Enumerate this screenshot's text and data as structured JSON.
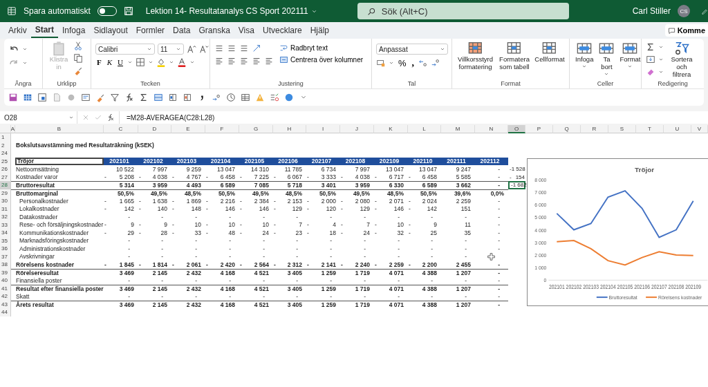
{
  "title_bar": {
    "autosave_label": "Spara automatiskt",
    "autosave_on": false,
    "document_title": "Lektion 14- Resultatanalys CS Sport 202111",
    "search_placeholder": "Sök (Alt+C)",
    "user_name": "Carl Stiller",
    "user_initials": "CS"
  },
  "menu_tabs": [
    {
      "label": "Arkiv",
      "selected": false
    },
    {
      "label": "Start",
      "selected": true
    },
    {
      "label": "Infoga",
      "selected": false
    },
    {
      "label": "Sidlayout",
      "selected": false
    },
    {
      "label": "Formler",
      "selected": false
    },
    {
      "label": "Data",
      "selected": false
    },
    {
      "label": "Granska",
      "selected": false
    },
    {
      "label": "Visa",
      "selected": false
    },
    {
      "label": "Utvecklare",
      "selected": false
    },
    {
      "label": "Hjälp",
      "selected": false
    }
  ],
  "comments_button": "Komme",
  "ribbon": {
    "undo_group": "Ångra",
    "clipboard": {
      "name": "Urklipp",
      "paste": "Klistra in",
      "paste_disabled": true
    },
    "font": {
      "name": "Tecken",
      "family": "Calibri",
      "size": "11",
      "bold": "F",
      "italic": "K",
      "underline": "U"
    },
    "alignment": {
      "name": "Justering",
      "wrap": "Radbryt text",
      "merge": "Centrera över kolumner"
    },
    "number": {
      "name": "Tal",
      "format": "Anpassat",
      "percent": "%",
      "comma": ","
    },
    "styles": {
      "name": "Format",
      "buttons": [
        "Villkorsstyrd formatering",
        "Formatera som tabell",
        "Cellformat"
      ]
    },
    "cells": {
      "name": "Celler",
      "buttons": [
        "Infoga",
        "Ta bort",
        "Format"
      ]
    },
    "editing": {
      "name": "Redigering",
      "sort": "Sortera och filtrera"
    }
  },
  "formula_bar": {
    "name_box": "O28",
    "formula": "=M28-AVERAGEA(C28:L28)"
  },
  "sheet": {
    "columns": [
      {
        "label": "A",
        "selected": false
      },
      {
        "label": "B",
        "selected": false
      },
      {
        "label": "C",
        "selected": false
      },
      {
        "label": "D",
        "selected": false
      },
      {
        "label": "E",
        "selected": false
      },
      {
        "label": "F",
        "selected": false
      },
      {
        "label": "G",
        "selected": false
      },
      {
        "label": "H",
        "selected": false
      },
      {
        "label": "I",
        "selected": false
      },
      {
        "label": "J",
        "selected": false
      },
      {
        "label": "K",
        "selected": false
      },
      {
        "label": "L",
        "selected": false
      },
      {
        "label": "M",
        "selected": false
      },
      {
        "label": "N",
        "selected": false
      },
      {
        "label": "O",
        "selected": true
      },
      {
        "label": "P",
        "selected": false
      },
      {
        "label": "Q",
        "selected": false
      },
      {
        "label": "R",
        "selected": false
      },
      {
        "label": "S",
        "selected": false
      },
      {
        "label": "T",
        "selected": false
      },
      {
        "label": "U",
        "selected": false
      },
      {
        "label": "V",
        "selected": false
      }
    ],
    "rows": [
      {
        "kind": "blank",
        "number": "1",
        "selected": false
      },
      {
        "kind": "title",
        "number": "2",
        "selected": false,
        "label": "Bokslutsavstämning med Resultaträkning (kSEK)"
      },
      {
        "kind": "blank",
        "number": "24",
        "selected": false
      },
      {
        "kind": "header",
        "number": "25",
        "selected": false,
        "label": "Tröjor",
        "months": [
          "202101",
          "202102",
          "202103",
          "202104",
          "202105",
          "202106",
          "202107",
          "202108",
          "202109",
          "202110",
          "202111",
          "202112"
        ]
      },
      {
        "kind": "data",
        "number": "26",
        "selected": false,
        "label": "Nettoomsättning",
        "bold": false,
        "indent": false,
        "border_top": false,
        "cells": [
          [
            "10 522"
          ],
          [
            "7 997"
          ],
          [
            "9 259"
          ],
          [
            "13 047"
          ],
          [
            "14 310"
          ],
          [
            "11 785"
          ],
          [
            "6 734"
          ],
          [
            "7 997"
          ],
          [
            "13 047"
          ],
          [
            "13 047"
          ],
          [
            "9 247"
          ],
          [
            "-"
          ]
        ],
        "extra": {
          "cell": [
            "-",
            "1 528"
          ],
          "selected": false
        }
      },
      {
        "kind": "data",
        "number": "27",
        "selected": false,
        "label": "Kostnader varor",
        "bold": false,
        "indent": false,
        "border_top": false,
        "cells": [
          [
            "-",
            "5 208"
          ],
          [
            "-",
            "4 038"
          ],
          [
            "-",
            "4 767"
          ],
          [
            "-",
            "6 458"
          ],
          [
            "-",
            "7 225"
          ],
          [
            "-",
            "6 067"
          ],
          [
            "-",
            "3 333"
          ],
          [
            "-",
            "4 038"
          ],
          [
            "-",
            "6 717"
          ],
          [
            "-",
            "6 458"
          ],
          [
            "5 585"
          ],
          [
            "-"
          ]
        ],
        "extra": {
          "cell": [
            "-",
            "154"
          ],
          "selected": false
        }
      },
      {
        "kind": "data",
        "number": "28",
        "selected": true,
        "label": "Bruttoresultat",
        "bold": true,
        "indent": false,
        "border_top": true,
        "cells": [
          [
            "5 314"
          ],
          [
            "3 959"
          ],
          [
            "4 493"
          ],
          [
            "6 589"
          ],
          [
            "7 085"
          ],
          [
            "5 718"
          ],
          [
            "3 401"
          ],
          [
            "3 959"
          ],
          [
            "6 330"
          ],
          [
            "6 589"
          ],
          [
            "3 662"
          ],
          [
            "-"
          ]
        ],
        "extra": {
          "cell": [
            "-",
            "1 682"
          ],
          "selected": true
        }
      },
      {
        "kind": "data",
        "number": "29",
        "selected": false,
        "label": "Bruttomarginal",
        "bold": true,
        "indent": false,
        "border_top": true,
        "cells": [
          [
            "50,5%"
          ],
          [
            "49,5%"
          ],
          [
            "48,5%"
          ],
          [
            "50,5%"
          ],
          [
            "49,5%"
          ],
          [
            "48,5%"
          ],
          [
            "50,5%"
          ],
          [
            "49,5%"
          ],
          [
            "48,5%"
          ],
          [
            "50,5%"
          ],
          [
            "39,6%"
          ],
          [
            "0,0%"
          ]
        ]
      },
      {
        "kind": "data",
        "number": "30",
        "selected": false,
        "label": "Personalkostnader",
        "bold": false,
        "indent": true,
        "border_top": false,
        "cells": [
          [
            "-",
            "1 665"
          ],
          [
            "-",
            "1 638"
          ],
          [
            "-",
            "1 869"
          ],
          [
            "-",
            "2 216"
          ],
          [
            "-",
            "2 384"
          ],
          [
            "-",
            "2 153"
          ],
          [
            "-",
            "2 000"
          ],
          [
            "-",
            "2 080"
          ],
          [
            "-",
            "2 071"
          ],
          [
            "-",
            "2 024"
          ],
          [
            "2 259"
          ],
          [
            "-"
          ]
        ]
      },
      {
        "kind": "data",
        "number": "31",
        "selected": false,
        "label": "Lokalkostnader",
        "bold": false,
        "indent": true,
        "border_top": false,
        "cells": [
          [
            "-",
            "142"
          ],
          [
            "-",
            "140"
          ],
          [
            "-",
            "148"
          ],
          [
            "-",
            "146"
          ],
          [
            "-",
            "146"
          ],
          [
            "-",
            "129"
          ],
          [
            "-",
            "120"
          ],
          [
            "-",
            "129"
          ],
          [
            "-",
            "146"
          ],
          [
            "-",
            "142"
          ],
          [
            "151"
          ],
          [
            "-"
          ]
        ]
      },
      {
        "kind": "data",
        "number": "32",
        "selected": false,
        "label": "Datakostnader",
        "bold": false,
        "indent": true,
        "border_top": false,
        "cells": [
          [
            "-"
          ],
          [
            "-"
          ],
          [
            "-"
          ],
          [
            "-"
          ],
          [
            "-"
          ],
          [
            "-"
          ],
          [
            "-"
          ],
          [
            "-"
          ],
          [
            "-"
          ],
          [
            "-"
          ],
          [
            "-"
          ],
          [
            "-"
          ]
        ]
      },
      {
        "kind": "data",
        "number": "33",
        "selected": false,
        "label": "Rese- och försäljningskostnader",
        "bold": false,
        "indent": true,
        "border_top": false,
        "cells": [
          [
            "-",
            "9"
          ],
          [
            "-",
            "9"
          ],
          [
            "-",
            "10"
          ],
          [
            "-",
            "10"
          ],
          [
            "-",
            "10"
          ],
          [
            "-",
            "7"
          ],
          [
            "-",
            "4"
          ],
          [
            "-",
            "7"
          ],
          [
            "-",
            "10"
          ],
          [
            "-",
            "9"
          ],
          [
            "11"
          ],
          [
            "-"
          ]
        ]
      },
      {
        "kind": "data",
        "number": "34",
        "selected": false,
        "label": "Kommunikationskostnader",
        "bold": false,
        "indent": true,
        "border_top": false,
        "cells": [
          [
            "-",
            "29"
          ],
          [
            "-",
            "28"
          ],
          [
            "-",
            "33"
          ],
          [
            "-",
            "48"
          ],
          [
            "-",
            "24"
          ],
          [
            "-",
            "23"
          ],
          [
            "-",
            "18"
          ],
          [
            "-",
            "24"
          ],
          [
            "-",
            "32"
          ],
          [
            "-",
            "25"
          ],
          [
            "35"
          ],
          [
            "-"
          ]
        ]
      },
      {
        "kind": "data",
        "number": "35",
        "selected": false,
        "label": "Marknadsföringskostnader",
        "bold": false,
        "indent": true,
        "border_top": false,
        "cells": [
          [
            "-"
          ],
          [
            "-"
          ],
          [
            "-"
          ],
          [
            "-"
          ],
          [
            "-"
          ],
          [
            "-"
          ],
          [
            "-"
          ],
          [
            "-"
          ],
          [
            "-"
          ],
          [
            "-"
          ],
          [
            "-"
          ],
          [
            "-"
          ]
        ]
      },
      {
        "kind": "data",
        "number": "36",
        "selected": false,
        "label": "Administrationskostnader",
        "bold": false,
        "indent": true,
        "border_top": false,
        "cells": [
          [
            "-"
          ],
          [
            "-"
          ],
          [
            "-"
          ],
          [
            "-"
          ],
          [
            "-"
          ],
          [
            "-"
          ],
          [
            "-"
          ],
          [
            "-"
          ],
          [
            "-"
          ],
          [
            "-"
          ],
          [
            "-"
          ],
          [
            "-"
          ]
        ]
      },
      {
        "kind": "data",
        "number": "37",
        "selected": false,
        "label": "Avskrivningar",
        "bold": false,
        "indent": true,
        "border_top": false,
        "cells": [
          [
            "-"
          ],
          [
            "-"
          ],
          [
            "-"
          ],
          [
            "-"
          ],
          [
            "-"
          ],
          [
            "-"
          ],
          [
            "-"
          ],
          [
            "-"
          ],
          [
            "-"
          ],
          [
            "-"
          ],
          [
            "-"
          ],
          []
        ]
      },
      {
        "kind": "data",
        "number": "38",
        "selected": false,
        "label": "Rörelsens kostnader",
        "bold": true,
        "indent": false,
        "border_top": false,
        "cells": [
          [
            "-",
            "1 845"
          ],
          [
            "-",
            "1 814"
          ],
          [
            "-",
            "2 061"
          ],
          [
            "-",
            "2 420"
          ],
          [
            "-",
            "2 564"
          ],
          [
            "-",
            "2 312"
          ],
          [
            "-",
            "2 141"
          ],
          [
            "-",
            "2 240"
          ],
          [
            "-",
            "2 259"
          ],
          [
            "-",
            "2 200"
          ],
          [
            "2 455"
          ],
          [
            "-"
          ]
        ]
      },
      {
        "kind": "data",
        "number": "39",
        "selected": false,
        "label": "Rörelseresultat",
        "bold": true,
        "indent": false,
        "border_top": true,
        "cells": [
          [
            "3 469"
          ],
          [
            "2 145"
          ],
          [
            "2 432"
          ],
          [
            "4 168"
          ],
          [
            "4 521"
          ],
          [
            "3 405"
          ],
          [
            "1 259"
          ],
          [
            "1 719"
          ],
          [
            "4 071"
          ],
          [
            "4 388"
          ],
          [
            "1 207"
          ],
          [
            "-"
          ]
        ]
      },
      {
        "kind": "data",
        "number": "40",
        "selected": false,
        "label": "Finansiella poster",
        "bold": false,
        "indent": false,
        "border_top": false,
        "cells": [
          [
            "-"
          ],
          [
            "-"
          ],
          [
            "-"
          ],
          [
            "-"
          ],
          [
            "-"
          ],
          [
            "-"
          ],
          [
            "-"
          ],
          [
            "-"
          ],
          [
            "-"
          ],
          [
            "-"
          ],
          [
            "-"
          ],
          [
            "-"
          ]
        ]
      },
      {
        "kind": "data",
        "number": "41",
        "selected": false,
        "label": "Resultat efter finansiella poster",
        "bold": true,
        "indent": false,
        "border_top": true,
        "cells": [
          [
            "3 469"
          ],
          [
            "2 145"
          ],
          [
            "2 432"
          ],
          [
            "4 168"
          ],
          [
            "4 521"
          ],
          [
            "3 405"
          ],
          [
            "1 259"
          ],
          [
            "1 719"
          ],
          [
            "4 071"
          ],
          [
            "4 388"
          ],
          [
            "1 207"
          ],
          [
            "-"
          ]
        ]
      },
      {
        "kind": "data",
        "number": "42",
        "selected": false,
        "label": "Skatt",
        "bold": false,
        "indent": false,
        "border_top": false,
        "cells": [
          [
            "-"
          ],
          [
            "-"
          ],
          [
            "-"
          ],
          [
            "-"
          ],
          [
            "-"
          ],
          [
            "-"
          ],
          [
            "-"
          ],
          [
            "-"
          ],
          [
            "-"
          ],
          [
            "-"
          ],
          [
            "-"
          ],
          [
            "-"
          ]
        ]
      },
      {
        "kind": "data",
        "number": "43",
        "selected": false,
        "label": "Årets resultat",
        "bold": true,
        "indent": false,
        "border_top": true,
        "cells": [
          [
            "3 469"
          ],
          [
            "2 145"
          ],
          [
            "2 432"
          ],
          [
            "4 168"
          ],
          [
            "4 521"
          ],
          [
            "3 405"
          ],
          [
            "1 259"
          ],
          [
            "1 719"
          ],
          [
            "4 071"
          ],
          [
            "4 388"
          ],
          [
            "1 207"
          ],
          [
            "-"
          ]
        ]
      },
      {
        "kind": "blank",
        "number": "44",
        "selected": false
      }
    ],
    "chart": {
      "chart_data": {
        "type": "line",
        "title": "Tröjor",
        "categories": [
          "202101",
          "202102",
          "202103",
          "202104",
          "202105",
          "202106",
          "202107",
          "202108",
          "202109"
        ],
        "series": [
          {
            "name": "Bruttoresultat",
            "color": "#4472c4",
            "values": [
              5300,
              4000,
              4500,
              6600,
              7100,
              5700,
              3400,
              4000,
              6300
            ]
          },
          {
            "name": "Rörelsens kostnader",
            "color": "#ed7d31",
            "values": [
              3050,
              3150,
              2500,
              1550,
              1200,
              1800,
              2250,
              2000,
              1950
            ]
          }
        ],
        "legend": "bottom",
        "ylim": [
          0,
          8000
        ],
        "yticks": [
          {
            "value": 0,
            "label": "0"
          },
          {
            "value": 1000,
            "label": "1 000"
          },
          {
            "value": 2000,
            "label": "2 000"
          },
          {
            "value": 3000,
            "label": "3 000"
          },
          {
            "value": 4000,
            "label": "4 000"
          },
          {
            "value": 5000,
            "label": "5 000"
          },
          {
            "value": 6000,
            "label": "6 000"
          },
          {
            "value": 7000,
            "label": "7 000"
          },
          {
            "value": 8000,
            "label": "8 000"
          }
        ]
      }
    }
  }
}
